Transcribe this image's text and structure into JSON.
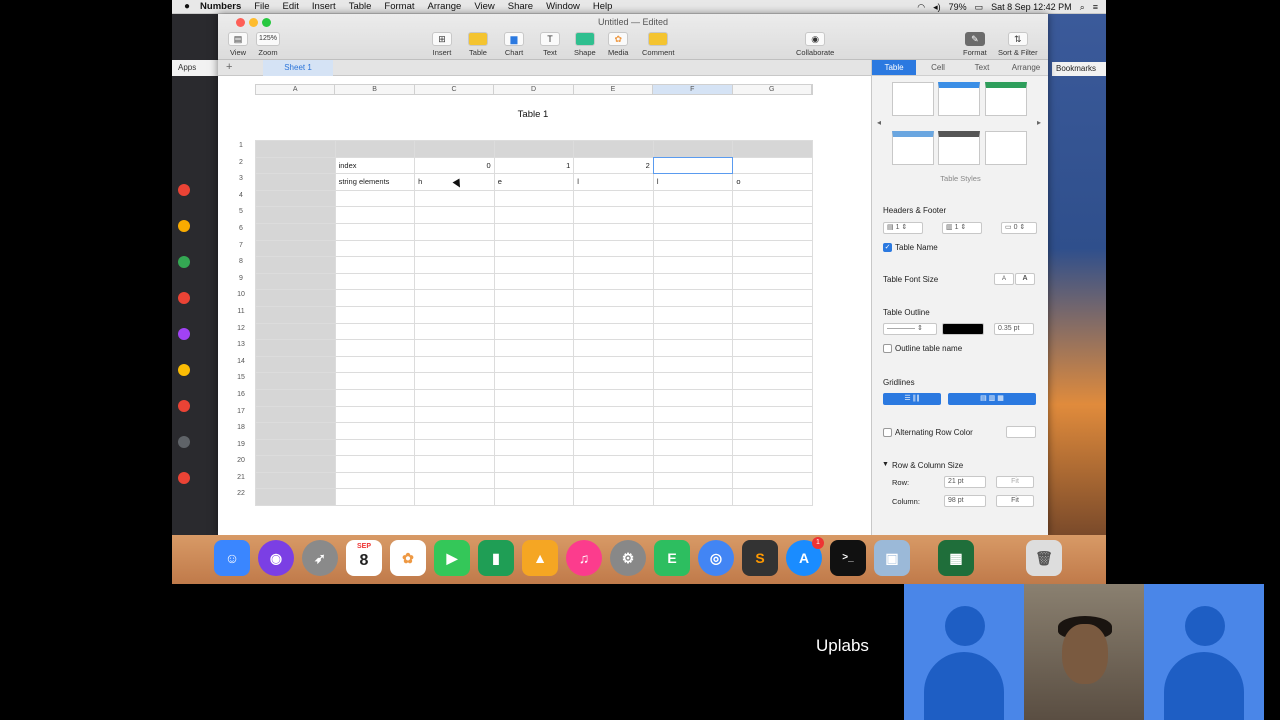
{
  "menubar": {
    "app_name": "Numbers",
    "items": [
      "File",
      "Edit",
      "Insert",
      "Table",
      "Format",
      "Arrange",
      "View",
      "Share",
      "Window",
      "Help"
    ],
    "battery": "79%",
    "datetime": "Sat 8 Sep  12:42 PM"
  },
  "browser": {
    "apps_label": "Apps",
    "bookmarks_label": "Bookmarks"
  },
  "window": {
    "title": "Untitled — Edited",
    "toolbar": {
      "view": "View",
      "zoom_value": "125%",
      "zoom": "Zoom",
      "insert": "Insert",
      "table": "Table",
      "chart": "Chart",
      "text": "Text",
      "shape": "Shape",
      "media": "Media",
      "comment": "Comment",
      "collaborate": "Collaborate",
      "format": "Format",
      "sort_filter": "Sort & Filter"
    },
    "sheet_tab": "Sheet 1"
  },
  "table": {
    "title": "Table 1",
    "columns": [
      "A",
      "B",
      "C",
      "D",
      "E",
      "F",
      "G"
    ],
    "row_numbers": [
      "1",
      "2",
      "3",
      "4",
      "5",
      "6",
      "7",
      "8",
      "9",
      "10",
      "11",
      "12",
      "13",
      "14",
      "15",
      "16",
      "17",
      "18",
      "19",
      "20",
      "21",
      "22"
    ],
    "row2": {
      "label": "index",
      "c": "0",
      "d": "1",
      "e": "2"
    },
    "row3": {
      "label": "string elements",
      "c": "h",
      "d": "e",
      "e": "l",
      "f": "l",
      "g": "o"
    }
  },
  "panel": {
    "tabs": [
      "Table",
      "Cell",
      "Text",
      "Arrange"
    ],
    "table_styles": "Table Styles",
    "headers_footer": "Headers & Footer",
    "header_rows": "1",
    "header_cols": "1",
    "footer_rows": "0",
    "table_name": "Table Name",
    "table_font_size": "Table Font Size",
    "font_small": "A",
    "font_large": "A",
    "table_outline": "Table Outline",
    "outline_width": "0.35 pt",
    "outline_table_name": "Outline table name",
    "gridlines": "Gridlines",
    "alternating_row_color": "Alternating Row Color",
    "row_column_size": "Row & Column Size",
    "row_label": "Row:",
    "row_value": "21 pt",
    "column_label": "Column:",
    "column_value": "98 pt",
    "fit": "Fit"
  },
  "dock": {
    "calendar_day": "8",
    "calendar_month": "SEP",
    "badge": "1"
  },
  "meet": {
    "presenter": "Uplabs"
  },
  "colors": {
    "accent": "#2b79e0",
    "selection": "#5a9bef",
    "header_fill": "#d6d6d6"
  }
}
